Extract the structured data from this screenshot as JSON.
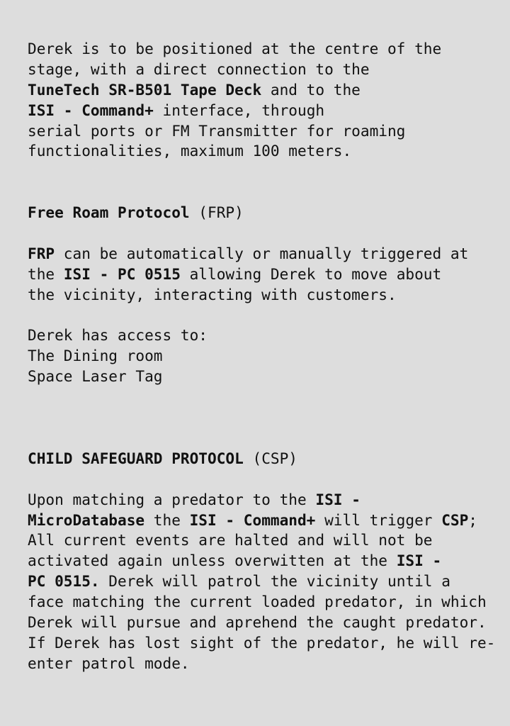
{
  "intro": {
    "l1": "Derek is to be positioned at the centre of the",
    "l2": "stage, with a direct connection to the",
    "l3_bold": "TuneTech SR-B501 Tape Deck",
    "l3_rest": " and to the",
    "l4_bold": "ISI - Command+",
    "l4_rest": " interface, through",
    "l5": "serial ports or FM Transmitter for roaming",
    "l6": "functionalities, maximum 100 meters."
  },
  "frp": {
    "heading_bold": "Free Roam Protocol",
    "heading_rest": " (FRP)",
    "p1_l1_bold": "FRP",
    "p1_l1_rest": " can be automatically or manually triggered at",
    "p1_l2_a": "the ",
    "p1_l2_bold": "ISI - PC 0515",
    "p1_l2_rest": " allowing Derek to move about",
    "p1_l3": "the vicinity, interacting with customers.",
    "access_intro": "Derek has access to:",
    "access_items": [
      "The Dining room",
      "Space Laser Tag"
    ]
  },
  "csp": {
    "heading_bold": "CHILD SAFEGUARD PROTOCOL",
    "heading_rest": " (CSP)",
    "l1_a": "Upon matching a predator to the ",
    "l1_bold": "ISI -",
    "l2_bold": "MicroDatabase",
    "l2_b": " the ",
    "l2_bold2": "ISI - Command+",
    "l2_c": " will trigger ",
    "l2_bold3": "CSP",
    "l2_d": ";",
    "l3": "All current events are halted and will not be",
    "l4_a": "activated again unless overwitten at the ",
    "l4_bold": "ISI -",
    "l5_bold": "PC 0515.",
    "l5_rest": " Derek will patrol the vicinity until a",
    "l6": "face matching the current loaded predator, in which",
    "l7": "Derek will pursue and aprehend the caught predator.",
    "l8": "If Derek has lost sight of the predator, he will re-",
    "l9": "enter patrol mode."
  }
}
